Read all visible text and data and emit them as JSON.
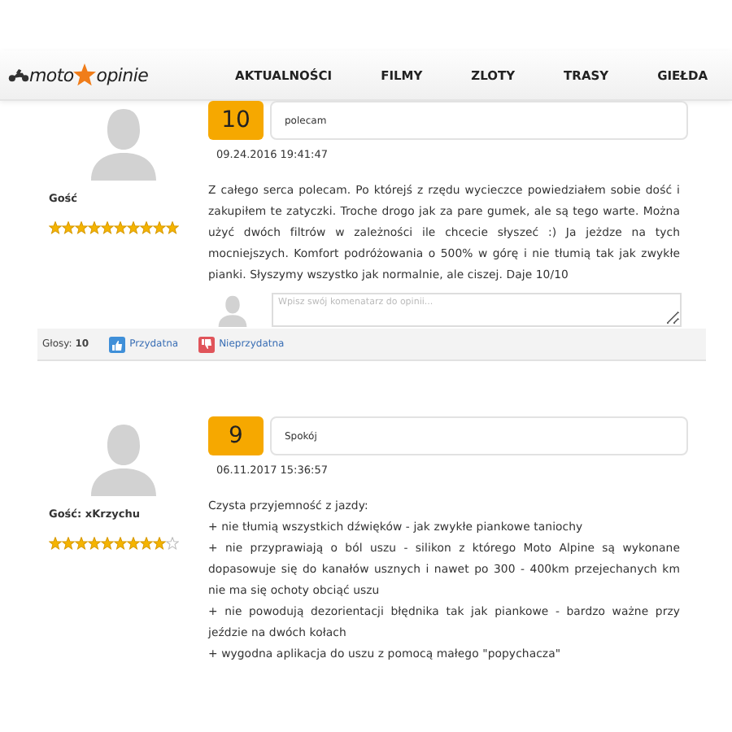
{
  "header": {
    "logo": {
      "left": "moto",
      "right": "opinie"
    },
    "nav": [
      "AKTUALNOŚCI",
      "FILMY",
      "ZLOTY",
      "TRASY",
      "GIEŁDA"
    ]
  },
  "reviews": [
    {
      "score": "10",
      "title": "polecam",
      "date": "09.24.2016 19:41:47",
      "author": "Gość",
      "stars": 10,
      "body": [
        "Z całego serca polecam. Po którejś z rzędu wycieczce powiedziałem sobie dość i zakupiłem te zatyczki. Troche drogo jak za pare gumek, ale są tego warte. Można użyć dwóch filtrów w zależności ile chcecie słyszeć :) Ja jeżdze na tych mocniejszych. Komfort podróżowania o 500% w górę i nie tłumią tak jak zwykłe pianki. Słyszymy wszystko jak normalnie, ale ciszej. Daje 10/10"
      ],
      "comment_placeholder": "Wpisz swój komenatarz do opinii...",
      "votes": {
        "label": "Głosy: **10**",
        "useful": "Przydatna",
        "not_useful": "Nieprzydatna"
      }
    },
    {
      "score": "9",
      "title": "Spokój",
      "date": "06.11.2017 15:36:57",
      "author": "Gość: xKrzychu",
      "stars": 9,
      "body": [
        "Czysta przyjemność z jazdy:",
        "+ nie tłumią wszystkich dźwięków - jak zwykłe piankowe taniochy",
        "+ nie przyprawiają o ból uszu - silikon z którego Moto Alpine są wykonane dopasowuje się do kanałów usznych i nawet po 300 - 400km przejechanych km nie ma się ochoty obciąć uszu",
        "+ nie powodują dezorientacji błędnika tak jak piankowe - bardzo ważne przy jeździe na dwóch kołach",
        "+ wygodna aplikacja do uszu z pomocą małego \"popychacza\""
      ]
    }
  ]
}
